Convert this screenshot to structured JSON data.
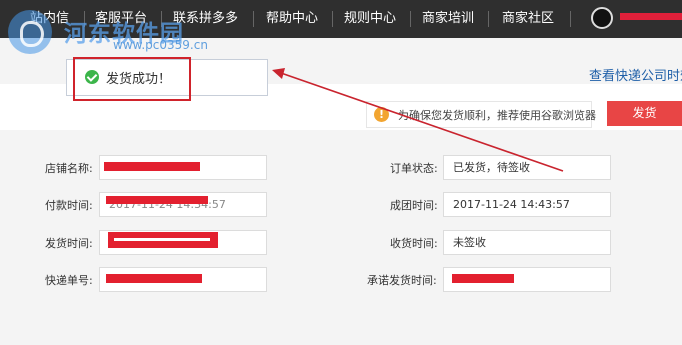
{
  "nav": {
    "items": [
      "站内信",
      "客服平台",
      "联系拼多多",
      "帮助中心",
      "规则中心",
      "商家培训",
      "商家社区"
    ]
  },
  "watermark": {
    "title": "河东软件园",
    "url": "www.pc0359.cn"
  },
  "toast": {
    "text": "发货成功！",
    "icon": "check-circle-icon"
  },
  "header": {
    "link": "查看快递公司时效"
  },
  "notice": {
    "icon": "warning-icon",
    "text": "为确保您发货顺利，推荐使用谷歌浏览器"
  },
  "ship_button": "发货",
  "form": {
    "left": [
      {
        "label": "店铺名称:",
        "value": ""
      },
      {
        "label": "付款时间:",
        "value": "2017-11-24 14:34:57"
      },
      {
        "label": "发货时间:",
        "value": ""
      },
      {
        "label": "快递单号:",
        "value": ""
      }
    ],
    "right": [
      {
        "label": "订单状态:",
        "value": "已发货，待签收"
      },
      {
        "label": "成团时间:",
        "value": "2017-11-24 14:43:57"
      },
      {
        "label": "收货时间:",
        "value": "未签收"
      },
      {
        "label": "承诺发货时间:",
        "value": ""
      }
    ]
  },
  "colors": {
    "nav_bg": "#2f2f2f",
    "highlight": "#d0232b",
    "button": "#e84545",
    "link": "#1f5fa8",
    "success": "#3cb54a",
    "warning": "#f2a531"
  }
}
